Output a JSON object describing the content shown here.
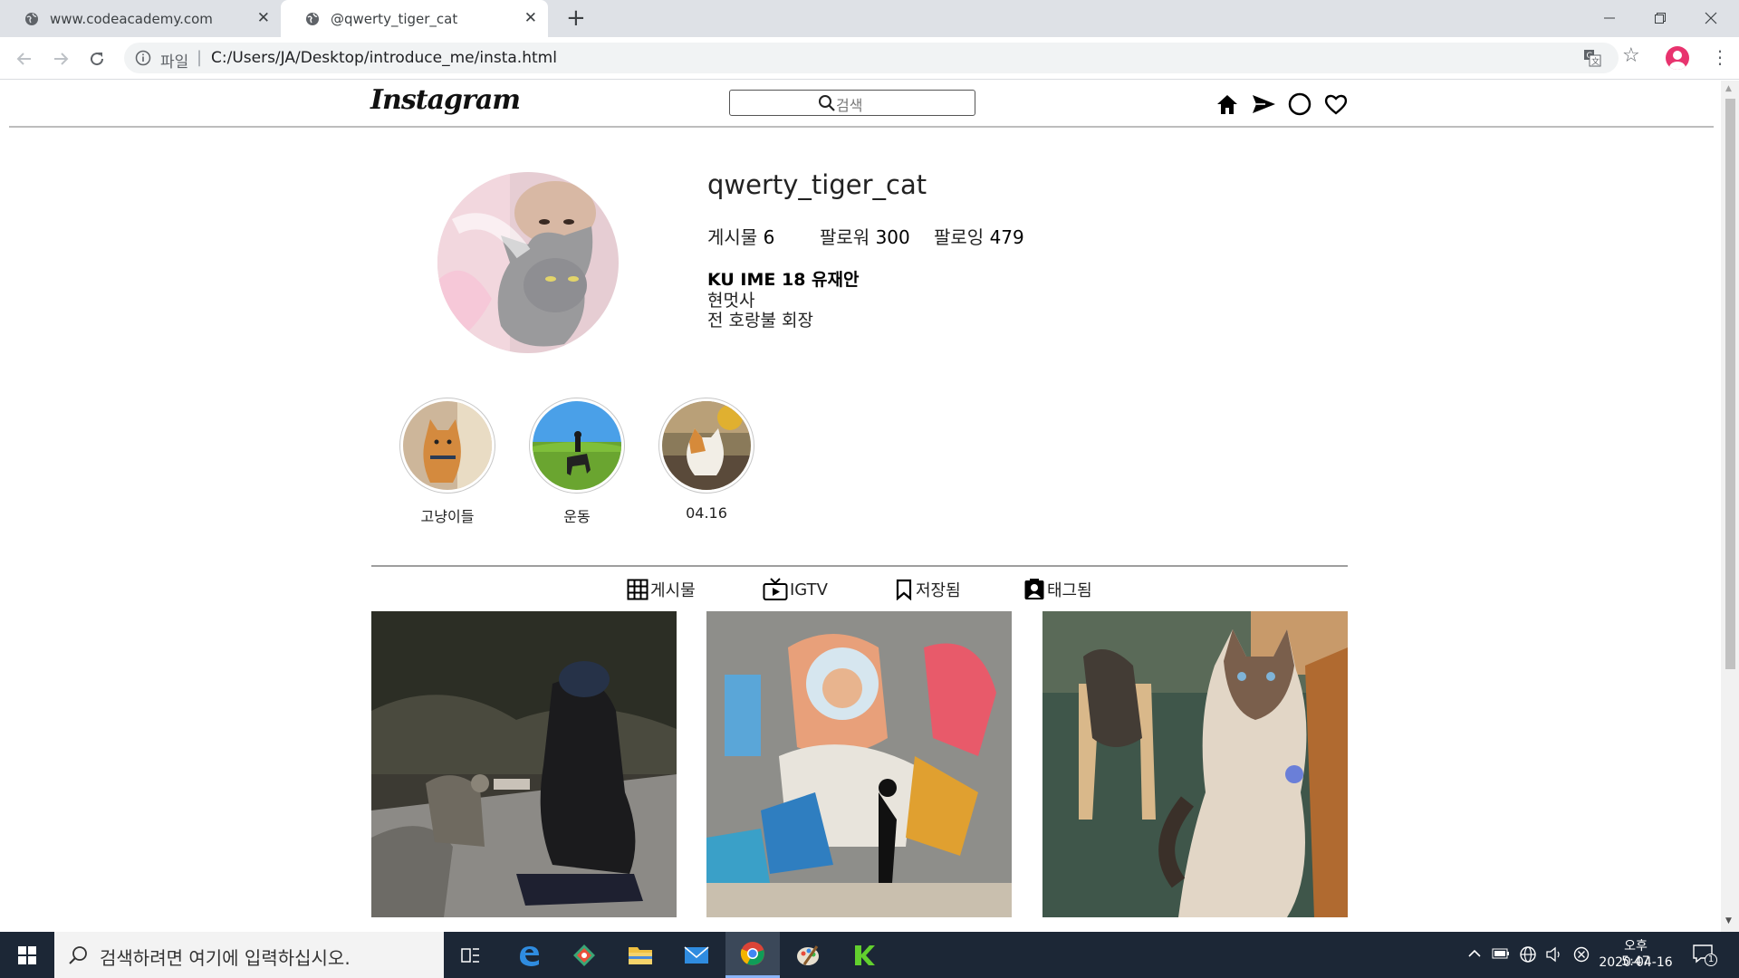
{
  "browser": {
    "tabs": [
      {
        "title": "www.codeacademy.com"
      },
      {
        "title": "@qwerty_tiger_cat"
      }
    ],
    "address": {
      "scheme": "파일",
      "separator": "|",
      "url": "C:/Users/JA/Desktop/introduce_me/insta.html"
    }
  },
  "header": {
    "logo": "Instagram",
    "search_placeholder": "검색",
    "nav_icons": [
      "home-icon",
      "direct-send-icon",
      "explore-circle-icon",
      "activity-heart-icon"
    ]
  },
  "profile": {
    "username": "qwerty_tiger_cat",
    "stats": [
      {
        "label": "게시물",
        "value": "6"
      },
      {
        "label": "팔로워",
        "value": "300"
      },
      {
        "label": "팔로잉",
        "value": "479"
      }
    ],
    "bio": {
      "name": "KU IME 18 유재안",
      "line1": "현멋사",
      "line2": "전 호랑불 회장"
    }
  },
  "highlights": [
    {
      "label": "고냥이들"
    },
    {
      "label": "운동"
    },
    {
      "label": "04.16"
    }
  ],
  "profile_tabs": [
    {
      "label": "게시물",
      "icon": "grid-icon"
    },
    {
      "label": "IGTV",
      "icon": "tv-icon"
    },
    {
      "label": "저장됨",
      "icon": "bookmark-icon"
    },
    {
      "label": "태그됨",
      "icon": "tagged-person-icon"
    }
  ],
  "taskbar": {
    "search_placeholder": "검색하려면 여기에 입력하십시오.",
    "clock_time": "오후 5:47",
    "clock_date": "2020-04-16",
    "notification_count": "1"
  }
}
